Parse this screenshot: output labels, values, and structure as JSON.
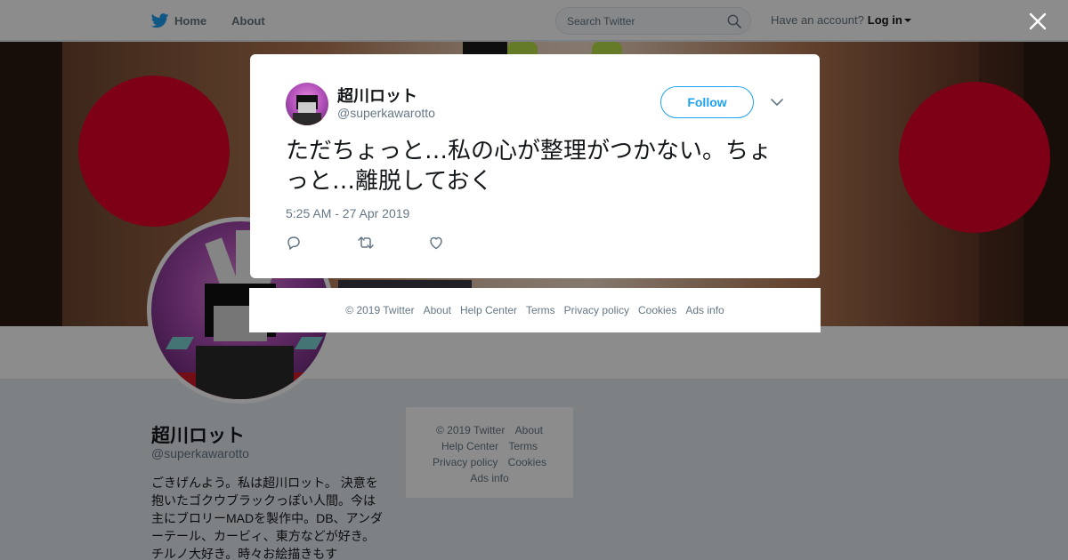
{
  "nav": {
    "home_label": "Home",
    "about_label": "About",
    "search_placeholder": "Search Twitter",
    "account_prompt": "Have an account?",
    "login_label": "Log in"
  },
  "profile": {
    "name": "超川ロット",
    "handle": "@superkawarotto",
    "bio": "ごきげんよう。私は超川ロット。 決意を抱いたゴクウブラックっぽい人間。今は主にブロリーMADを製作中。DB、アンダーテール、カービィ、東方などが好き。チルノ大好き。時々お絵描きもす"
  },
  "side_footer": {
    "copyright": "© 2019 Twitter",
    "about": "About",
    "help": "Help Center",
    "terms": "Terms",
    "privacy": "Privacy policy",
    "cookies": "Cookies",
    "ads": "Ads info"
  },
  "tweet": {
    "author_name": "超川ロット",
    "author_handle": "@superkawarotto",
    "follow_label": "Follow",
    "text": "ただちょっと…私の心が整理がつかない。ちょっと…離脱しておく",
    "timestamp": "5:25 AM - 27 Apr 2019"
  },
  "modal_footer": {
    "copyright": "© 2019 Twitter",
    "about": "About",
    "help": "Help Center",
    "terms": "Terms",
    "privacy": "Privacy policy",
    "cookies": "Cookies",
    "ads": "Ads info"
  },
  "icons": {
    "logo": "twitter-bird-icon",
    "search": "search-icon",
    "close": "close-icon",
    "reply": "reply-icon",
    "retweet": "retweet-icon",
    "like": "heart-icon",
    "more": "chevron-down-icon"
  },
  "colors": {
    "brand": "#1da1f2",
    "text": "#14171a",
    "muted": "#657786",
    "background": "#e6ecf0"
  }
}
